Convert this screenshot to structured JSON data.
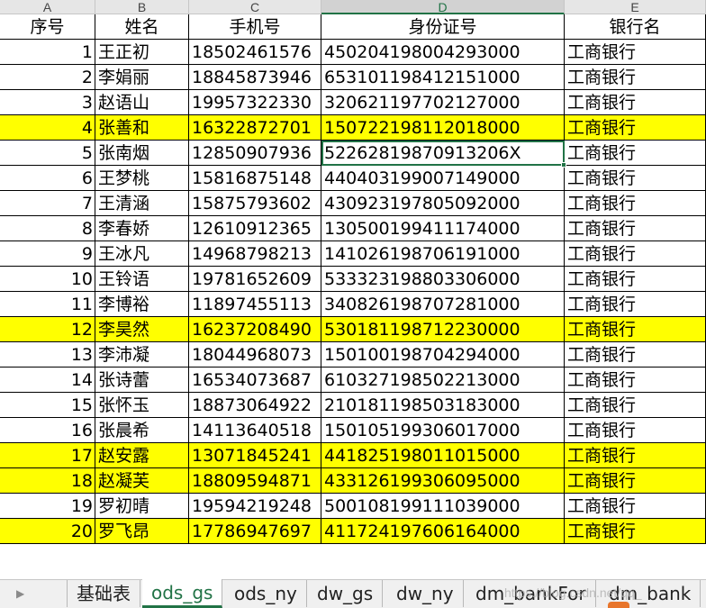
{
  "columns": [
    "A",
    "B",
    "C",
    "D",
    "E"
  ],
  "active_column": "D",
  "header": [
    "序号",
    "姓名",
    "手机号",
    "身份证号",
    "银行名"
  ],
  "rows": [
    {
      "no": "1",
      "name": "王正初",
      "phone": "18502461576",
      "id": "450204198004293000",
      "bank": "工商银行",
      "hl": false
    },
    {
      "no": "2",
      "name": "李娟丽",
      "phone": "18845873946",
      "id": "653101198412151000",
      "bank": "工商银行",
      "hl": false
    },
    {
      "no": "3",
      "name": "赵语山",
      "phone": "19957322330",
      "id": "320621197702127000",
      "bank": "工商银行",
      "hl": false
    },
    {
      "no": "4",
      "name": "张善和",
      "phone": "16322872701",
      "id": "150722198112018000",
      "bank": "工商银行",
      "hl": true
    },
    {
      "no": "5",
      "name": "张南烟",
      "phone": "12850907936",
      "id": "52262819870913206X",
      "bank": "工商银行",
      "hl": false
    },
    {
      "no": "6",
      "name": "王梦桃",
      "phone": "15816875148",
      "id": "440403199007149000",
      "bank": "工商银行",
      "hl": false
    },
    {
      "no": "7",
      "name": "王清涵",
      "phone": "15875793602",
      "id": "430923197805092000",
      "bank": "工商银行",
      "hl": false
    },
    {
      "no": "8",
      "name": "李春娇",
      "phone": "12610912365",
      "id": "130500199411174000",
      "bank": "工商银行",
      "hl": false
    },
    {
      "no": "9",
      "name": "王冰凡",
      "phone": "14968798213",
      "id": "141026198706191000",
      "bank": "工商银行",
      "hl": false
    },
    {
      "no": "10",
      "name": "王铃语",
      "phone": "19781652609",
      "id": "533323198803306000",
      "bank": "工商银行",
      "hl": false
    },
    {
      "no": "11",
      "name": "李博裕",
      "phone": "11897455113",
      "id": "340826198707281000",
      "bank": "工商银行",
      "hl": false
    },
    {
      "no": "12",
      "name": "李昊然",
      "phone": "16237208490",
      "id": "530181198712230000",
      "bank": "工商银行",
      "hl": true
    },
    {
      "no": "13",
      "name": "李沛凝",
      "phone": "18044968073",
      "id": "150100198704294000",
      "bank": "工商银行",
      "hl": false
    },
    {
      "no": "14",
      "name": "张诗蕾",
      "phone": "16534073687",
      "id": "610327198502213000",
      "bank": "工商银行",
      "hl": false
    },
    {
      "no": "15",
      "name": "张怀玉",
      "phone": "18873064922",
      "id": "210181198503183000",
      "bank": "工商银行",
      "hl": false
    },
    {
      "no": "16",
      "name": "张晨希",
      "phone": "14113640518",
      "id": "150105199306017000",
      "bank": "工商银行",
      "hl": false
    },
    {
      "no": "17",
      "name": "赵安露",
      "phone": "13071845241",
      "id": "441825198011015000",
      "bank": "工商银行",
      "hl": true
    },
    {
      "no": "18",
      "name": "赵凝芙",
      "phone": "18809594871",
      "id": "433126199306095000",
      "bank": "工商银行",
      "hl": true
    },
    {
      "no": "19",
      "name": "罗初晴",
      "phone": "19594219248",
      "id": "500108199111039000",
      "bank": "工商银行",
      "hl": false
    },
    {
      "no": "20",
      "name": "罗飞昂",
      "phone": "17786947697",
      "id": "411724197606164000",
      "bank": "工商银行",
      "hl": true
    }
  ],
  "sheet_tabs": [
    "基础表",
    "ods_gs",
    "ods_ny",
    "dw_gs",
    "dw_ny",
    "dm_bankFor",
    "dm_bank"
  ],
  "active_tab": "ods_gs",
  "highlight_color": "#ffff00",
  "accent_color": "#217346",
  "watermark": "https://blog.csdn.net/qq_"
}
